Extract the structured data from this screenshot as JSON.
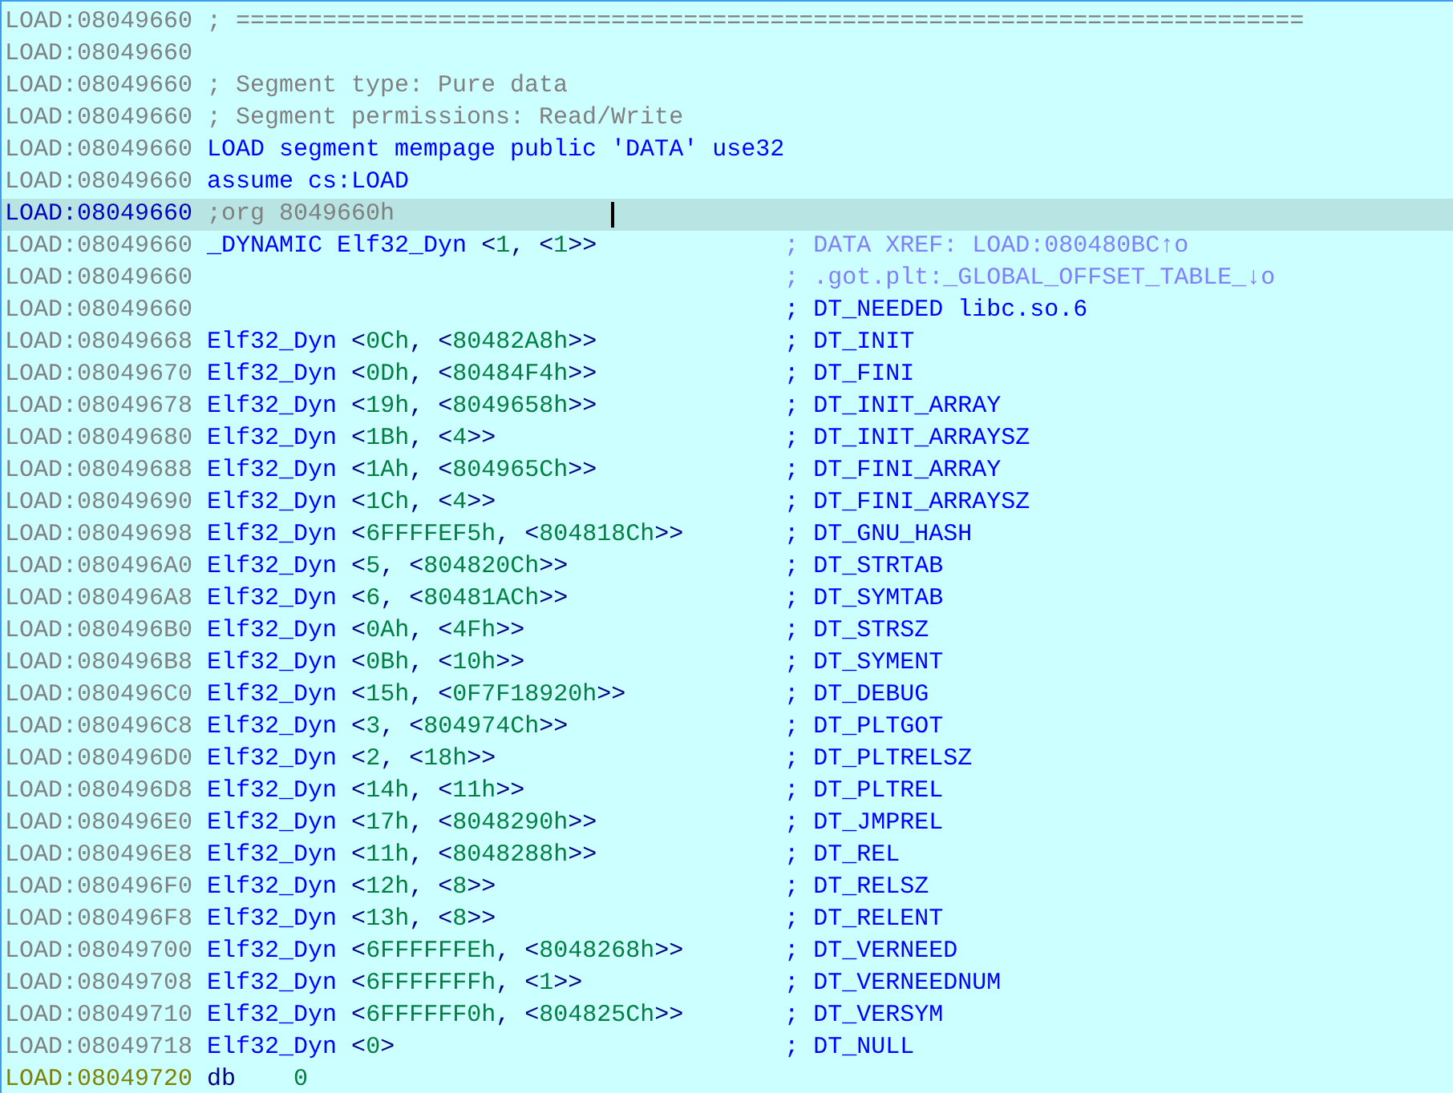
{
  "lines": [
    {
      "address": "LOAD:08049660",
      "selected": false,
      "kind": "comment",
      "code": "; =========================================================================="
    },
    {
      "address": "LOAD:08049660",
      "selected": false,
      "kind": "empty"
    },
    {
      "address": "LOAD:08049660",
      "selected": false,
      "kind": "comment",
      "code": "; Segment type: Pure data"
    },
    {
      "address": "LOAD:08049660",
      "selected": false,
      "kind": "comment",
      "code": "; Segment permissions: Read/Write"
    },
    {
      "address": "LOAD:08049660",
      "selected": false,
      "kind": "directive",
      "code": "LOAD segment mempage public 'DATA' use32"
    },
    {
      "address": "LOAD:08049660",
      "selected": false,
      "kind": "directive",
      "code": "assume cs:LOAD"
    },
    {
      "address": "LOAD:08049660",
      "selected": true,
      "kind": "comment",
      "code": ";org 8049660h"
    },
    {
      "address": "LOAD:08049660",
      "selected": false,
      "kind": "struct",
      "label": "_DYNAMIC",
      "type": "Elf32_Dyn",
      "operands": "<1, <1>>",
      "comment": {
        "kind": "xref",
        "text": "; DATA XREF: LOAD:080480BC↑o"
      }
    },
    {
      "address": "LOAD:08049660",
      "selected": false,
      "kind": "empty",
      "comment": {
        "kind": "xref",
        "text": "; .got.plt:_GLOBAL_OFFSET_TABLE_↓o"
      }
    },
    {
      "address": "LOAD:08049660",
      "selected": false,
      "kind": "empty",
      "comment": {
        "kind": "auto",
        "text": "; DT_NEEDED libc.so.6"
      }
    },
    {
      "address": "LOAD:08049668",
      "selected": false,
      "kind": "struct",
      "type": "Elf32_Dyn",
      "operands": "<0Ch, <80482A8h>>",
      "comment": {
        "kind": "auto",
        "text": "; DT_INIT"
      }
    },
    {
      "address": "LOAD:08049670",
      "selected": false,
      "kind": "struct",
      "type": "Elf32_Dyn",
      "operands": "<0Dh, <80484F4h>>",
      "comment": {
        "kind": "auto",
        "text": "; DT_FINI"
      }
    },
    {
      "address": "LOAD:08049678",
      "selected": false,
      "kind": "struct",
      "type": "Elf32_Dyn",
      "operands": "<19h, <8049658h>>",
      "comment": {
        "kind": "auto",
        "text": "; DT_INIT_ARRAY"
      }
    },
    {
      "address": "LOAD:08049680",
      "selected": false,
      "kind": "struct",
      "type": "Elf32_Dyn",
      "operands": "<1Bh, <4>>",
      "comment": {
        "kind": "auto",
        "text": "; DT_INIT_ARRAYSZ"
      }
    },
    {
      "address": "LOAD:08049688",
      "selected": false,
      "kind": "struct",
      "type": "Elf32_Dyn",
      "operands": "<1Ah, <804965Ch>>",
      "comment": {
        "kind": "auto",
        "text": "; DT_FINI_ARRAY"
      }
    },
    {
      "address": "LOAD:08049690",
      "selected": false,
      "kind": "struct",
      "type": "Elf32_Dyn",
      "operands": "<1Ch, <4>>",
      "comment": {
        "kind": "auto",
        "text": "; DT_FINI_ARRAYSZ"
      }
    },
    {
      "address": "LOAD:08049698",
      "selected": false,
      "kind": "struct",
      "type": "Elf32_Dyn",
      "operands": "<6FFFFEF5h, <804818Ch>>",
      "comment": {
        "kind": "auto",
        "text": "; DT_GNU_HASH"
      }
    },
    {
      "address": "LOAD:080496A0",
      "selected": false,
      "kind": "struct",
      "type": "Elf32_Dyn",
      "operands": "<5, <804820Ch>>",
      "comment": {
        "kind": "auto",
        "text": "; DT_STRTAB"
      }
    },
    {
      "address": "LOAD:080496A8",
      "selected": false,
      "kind": "struct",
      "type": "Elf32_Dyn",
      "operands": "<6, <80481ACh>>",
      "comment": {
        "kind": "auto",
        "text": "; DT_SYMTAB"
      }
    },
    {
      "address": "LOAD:080496B0",
      "selected": false,
      "kind": "struct",
      "type": "Elf32_Dyn",
      "operands": "<0Ah, <4Fh>>",
      "comment": {
        "kind": "auto",
        "text": "; DT_STRSZ"
      }
    },
    {
      "address": "LOAD:080496B8",
      "selected": false,
      "kind": "struct",
      "type": "Elf32_Dyn",
      "operands": "<0Bh, <10h>>",
      "comment": {
        "kind": "auto",
        "text": "; DT_SYMENT"
      }
    },
    {
      "address": "LOAD:080496C0",
      "selected": false,
      "kind": "struct",
      "type": "Elf32_Dyn",
      "operands": "<15h, <0F7F18920h>>",
      "comment": {
        "kind": "auto",
        "text": "; DT_DEBUG"
      }
    },
    {
      "address": "LOAD:080496C8",
      "selected": false,
      "kind": "struct",
      "type": "Elf32_Dyn",
      "operands": "<3, <804974Ch>>",
      "comment": {
        "kind": "auto",
        "text": "; DT_PLTGOT"
      }
    },
    {
      "address": "LOAD:080496D0",
      "selected": false,
      "kind": "struct",
      "type": "Elf32_Dyn",
      "operands": "<2, <18h>>",
      "comment": {
        "kind": "auto",
        "text": "; DT_PLTRELSZ"
      }
    },
    {
      "address": "LOAD:080496D8",
      "selected": false,
      "kind": "struct",
      "type": "Elf32_Dyn",
      "operands": "<14h, <11h>>",
      "comment": {
        "kind": "auto",
        "text": "; DT_PLTREL"
      }
    },
    {
      "address": "LOAD:080496E0",
      "selected": false,
      "kind": "struct",
      "type": "Elf32_Dyn",
      "operands": "<17h, <8048290h>>",
      "comment": {
        "kind": "auto",
        "text": "; DT_JMPREL"
      }
    },
    {
      "address": "LOAD:080496E8",
      "selected": false,
      "kind": "struct",
      "type": "Elf32_Dyn",
      "operands": "<11h, <8048288h>>",
      "comment": {
        "kind": "auto",
        "text": "; DT_REL"
      }
    },
    {
      "address": "LOAD:080496F0",
      "selected": false,
      "kind": "struct",
      "type": "Elf32_Dyn",
      "operands": "<12h, <8>>",
      "comment": {
        "kind": "auto",
        "text": "; DT_RELSZ"
      }
    },
    {
      "address": "LOAD:080496F8",
      "selected": false,
      "kind": "struct",
      "type": "Elf32_Dyn",
      "operands": "<13h, <8>>",
      "comment": {
        "kind": "auto",
        "text": "; DT_RELENT"
      }
    },
    {
      "address": "LOAD:08049700",
      "selected": false,
      "kind": "struct",
      "type": "Elf32_Dyn",
      "operands": "<6FFFFFFEh, <8048268h>>",
      "comment": {
        "kind": "auto",
        "text": "; DT_VERNEED"
      }
    },
    {
      "address": "LOAD:08049708",
      "selected": false,
      "kind": "struct",
      "type": "Elf32_Dyn",
      "operands": "<6FFFFFFFh, <1>>",
      "comment": {
        "kind": "auto",
        "text": "; DT_VERNEEDNUM"
      }
    },
    {
      "address": "LOAD:08049710",
      "selected": false,
      "kind": "struct",
      "type": "Elf32_Dyn",
      "operands": "<6FFFFFF0h, <804825Ch>>",
      "comment": {
        "kind": "auto",
        "text": "; DT_VERSYM"
      }
    },
    {
      "address": "LOAD:08049718",
      "selected": false,
      "kind": "struct",
      "type": "Elf32_Dyn",
      "operands": "<0>",
      "comment": {
        "kind": "auto",
        "text": "; DT_NULL"
      }
    },
    {
      "address": "LOAD:08049720",
      "selected": false,
      "kind": "data",
      "mnemonic": "db",
      "operands": "0"
    }
  ]
}
